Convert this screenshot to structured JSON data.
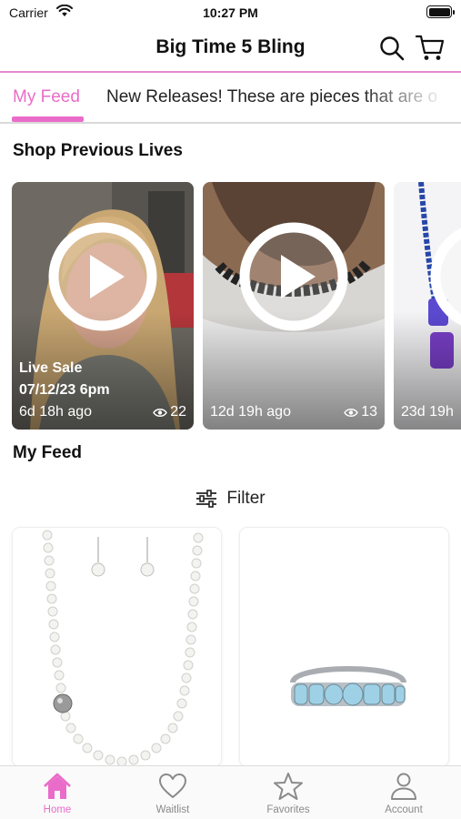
{
  "status_bar": {
    "carrier": "Carrier",
    "time": "10:27 PM"
  },
  "header": {
    "title": "Big Time 5 Bling",
    "icons": [
      "search-icon",
      "cart-icon"
    ],
    "accent_color": "#ea6cc9",
    "divider_color": "#e48ad1"
  },
  "tabs": [
    {
      "label": "My Feed",
      "selected": true
    },
    {
      "label": "New Releases! These are pieces that are o",
      "selected": false
    }
  ],
  "previous_lives": {
    "title": "Shop Previous Lives",
    "cards": [
      {
        "title": "Live Sale",
        "date": "07/12/23 6pm",
        "ago": "6d 18h ago",
        "views": "22",
        "icon": "play-icon"
      },
      {
        "title": "",
        "date": "",
        "ago": "12d 19h ago",
        "views": "13",
        "icon": "play-icon"
      },
      {
        "title": "",
        "date": "",
        "ago": "23d 19h",
        "views": "",
        "icon": "play-icon"
      }
    ]
  },
  "feed": {
    "title": "My Feed",
    "filter_label": "Filter",
    "filter_icon": "sliders-icon",
    "products": [
      {
        "image": "pearl-necklace-earrings"
      },
      {
        "image": "light-blue-stone-bracelet"
      }
    ]
  },
  "tab_bar": {
    "items": [
      {
        "label": "Home",
        "icon": "home-icon",
        "active": true
      },
      {
        "label": "Waitlist",
        "icon": "heart-icon",
        "active": false
      },
      {
        "label": "Favorites",
        "icon": "star-icon",
        "active": false
      },
      {
        "label": "Account",
        "icon": "account-icon",
        "active": false
      }
    ]
  }
}
